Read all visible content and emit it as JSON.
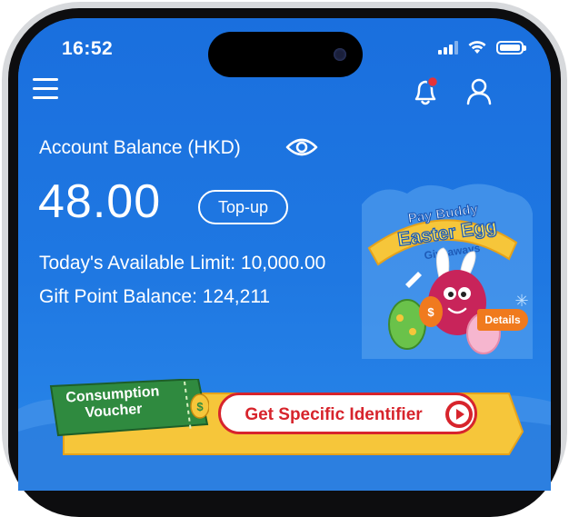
{
  "status_bar": {
    "time": "16:52"
  },
  "header": {
    "menu_icon": "hamburger-menu-icon",
    "notification_icon": "bell-icon",
    "profile_icon": "user-icon"
  },
  "account": {
    "balance_label": "Account Balance (HKD)",
    "visibility_icon": "eye-icon",
    "balance": "48.00",
    "topup_label": "Top-up",
    "available_limit": "Today's Available Limit: 10,000.00",
    "gift_points": "Gift Point Balance: 124,211"
  },
  "promo": {
    "line1": "Pay Buddy",
    "line2": "Easter Egg",
    "line3": "Giveaways",
    "details_label": "Details"
  },
  "voucher_banner": {
    "tag_text": "Consumption Voucher",
    "action_label": "Get Specific Identifier"
  },
  "colors": {
    "primary_blue": "#1f74dd",
    "accent_red": "#d7242c",
    "tag_green": "#2f8a3f",
    "promo_orange": "#f07a1e",
    "banner_yellow": "#f6c63a"
  }
}
